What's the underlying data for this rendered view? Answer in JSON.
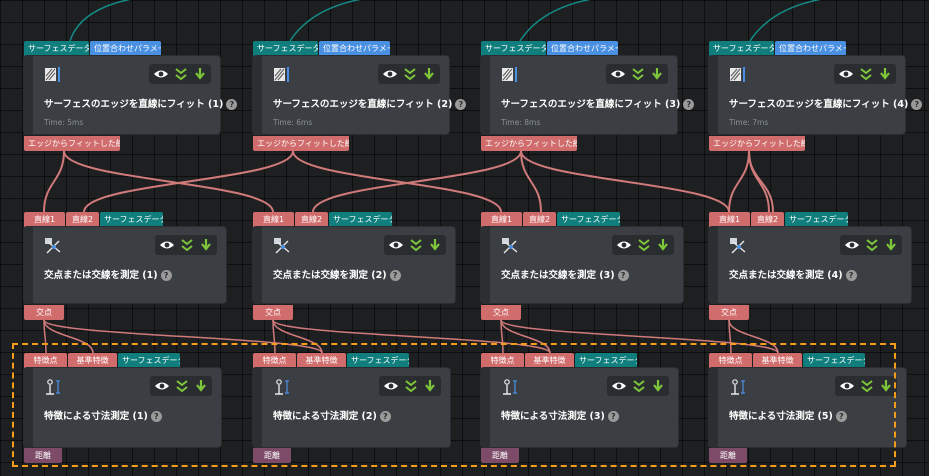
{
  "colors": {
    "canvas": "#1e1f21",
    "node": "#3b3f43",
    "teal_port": "#0f7e7d",
    "blue_port": "#4a90e2",
    "red_port": "#d06c6c",
    "purple_port": "#7d4a68",
    "wire_red": "#d07a7a",
    "wire_teal": "#138a86",
    "selection": "#f59c1a",
    "eye_icon": "#ffffff",
    "chevron_icon": "#7ec63a",
    "arrow_icon": "#7ec63a"
  },
  "row1": [
    {
      "inputs": [
        "サーフェスデータ",
        "位置合わせパラメータグループ"
      ],
      "title": "サーフェスのエッジを直線にフィット (1)",
      "time": "Time: 5ms",
      "output": "エッジからフィットした線",
      "icon": "surface-edge-icon"
    },
    {
      "inputs": [
        "サーフェスデータ",
        "位置合わせパラメータグループ"
      ],
      "title": "サーフェスのエッジを直線にフィット (2)",
      "time": "Time: 6ms",
      "output": "エッジからフィットした線",
      "icon": "surface-edge-icon"
    },
    {
      "inputs": [
        "サーフェスデータ",
        "位置合わせパラメータグループ"
      ],
      "title": "サーフェスのエッジを直線にフィット (3)",
      "time": "Time: 8ms",
      "output": "エッジからフィットした線",
      "icon": "surface-edge-icon"
    },
    {
      "inputs": [
        "サーフェスデータ",
        "位置合わせパラメータグループ"
      ],
      "title": "サーフェスのエッジを直線にフィット (4)",
      "time": "Time: 7ms",
      "output": "エッジからフィットした線",
      "icon": "surface-edge-icon"
    }
  ],
  "row2": [
    {
      "inputs": [
        "直線1",
        "直線2",
        "サーフェスデータ"
      ],
      "title": "交点または交線を測定 (1)",
      "output": "交点",
      "icon": "intersection-icon"
    },
    {
      "inputs": [
        "直線1",
        "直線2",
        "サーフェスデータ"
      ],
      "title": "交点または交線を測定 (2)",
      "output": "交点",
      "icon": "intersection-icon"
    },
    {
      "inputs": [
        "直線1",
        "直線2",
        "サーフェスデータ"
      ],
      "title": "交点または交線を測定 (3)",
      "output": "交点",
      "icon": "intersection-icon"
    },
    {
      "inputs": [
        "直線1",
        "直線2",
        "サーフェスデータ"
      ],
      "title": "交点または交線を測定 (4)",
      "output": "交点",
      "icon": "intersection-icon"
    }
  ],
  "row3": [
    {
      "inputs": [
        "特徴点",
        "基準特徴",
        "サーフェスデータ"
      ],
      "title": "特徴による寸法測定 (1)",
      "output": "距離",
      "icon": "dimension-icon"
    },
    {
      "inputs": [
        "特徴点",
        "基準特徴",
        "サーフェスデータ"
      ],
      "title": "特徴による寸法測定 (2)",
      "output": "距離",
      "icon": "dimension-icon"
    },
    {
      "inputs": [
        "特徴点",
        "基準特徴",
        "サーフェスデータ"
      ],
      "title": "特徴による寸法測定 (3)",
      "output": "距離",
      "icon": "dimension-icon"
    },
    {
      "inputs": [
        "特徴点",
        "基準特徴",
        "サーフェスデータ"
      ],
      "title": "特徴による寸法測定 (5)",
      "output": "距離",
      "icon": "dimension-icon"
    }
  ],
  "help_label": "?"
}
